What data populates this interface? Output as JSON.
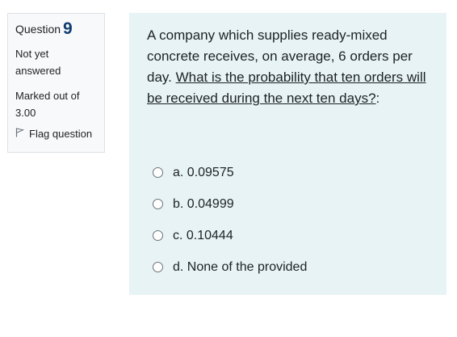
{
  "question_info": {
    "question_label": "Question",
    "question_number": "9",
    "state": "Not yet answered",
    "grade": "Marked out of 3.00",
    "flag_label": "Flag question"
  },
  "question": {
    "text_plain": "A company which supplies ready-mixed concrete receives, on average, 6 orders per day. ",
    "text_underlined": "What is the probability that ten orders will be received during the next ten days?",
    "text_suffix": ":"
  },
  "answers": [
    {
      "label": "a. 0.09575"
    },
    {
      "label": "b. 0.04999"
    },
    {
      "label": "c. 0.10444"
    },
    {
      "label": "d. None of the provided"
    }
  ],
  "colors": {
    "info_bg": "#f8f9fa",
    "content_bg": "#e7f3f5",
    "question_number": "#0f3c6e"
  }
}
